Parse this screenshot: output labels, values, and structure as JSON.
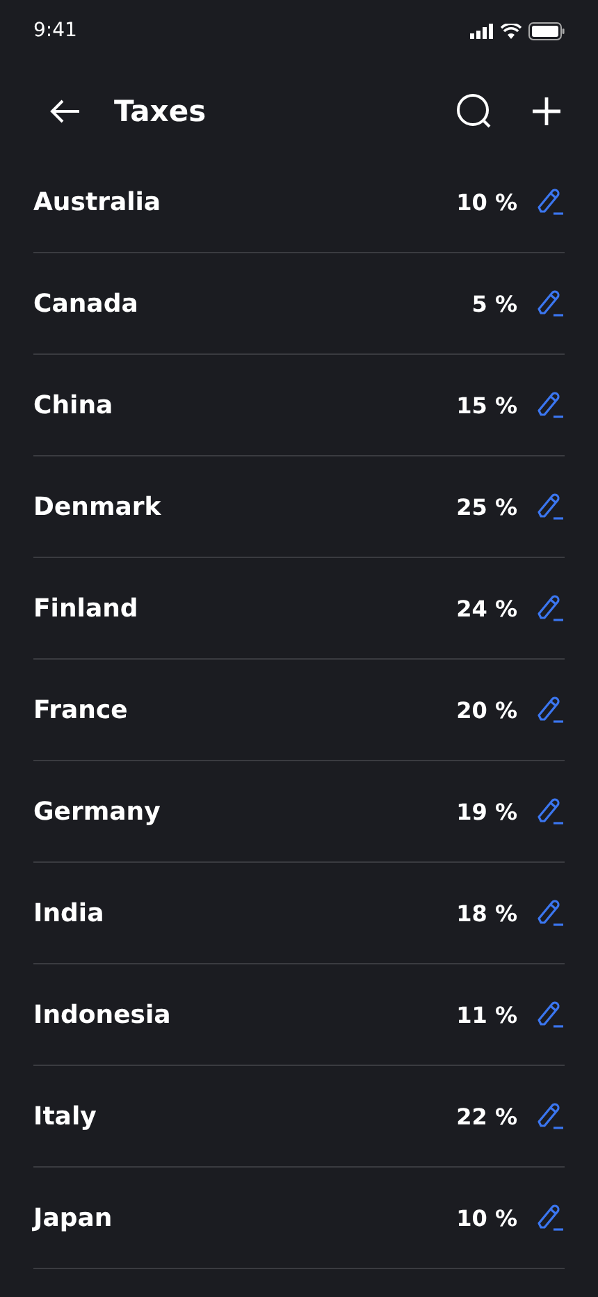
{
  "status_bar": {
    "time": "9:41"
  },
  "header": {
    "title": "Taxes"
  },
  "taxes": [
    {
      "country": "Australia",
      "rate": "10 %"
    },
    {
      "country": "Canada",
      "rate": "5 %"
    },
    {
      "country": "China",
      "rate": "15 %"
    },
    {
      "country": "Denmark",
      "rate": "25 %"
    },
    {
      "country": "Finland",
      "rate": "24 %"
    },
    {
      "country": "France",
      "rate": "20 %"
    },
    {
      "country": "Germany",
      "rate": "19 %"
    },
    {
      "country": "India",
      "rate": "18 %"
    },
    {
      "country": "Indonesia",
      "rate": "11 %"
    },
    {
      "country": "Italy",
      "rate": "22 %"
    },
    {
      "country": "Japan",
      "rate": "10 %"
    }
  ]
}
